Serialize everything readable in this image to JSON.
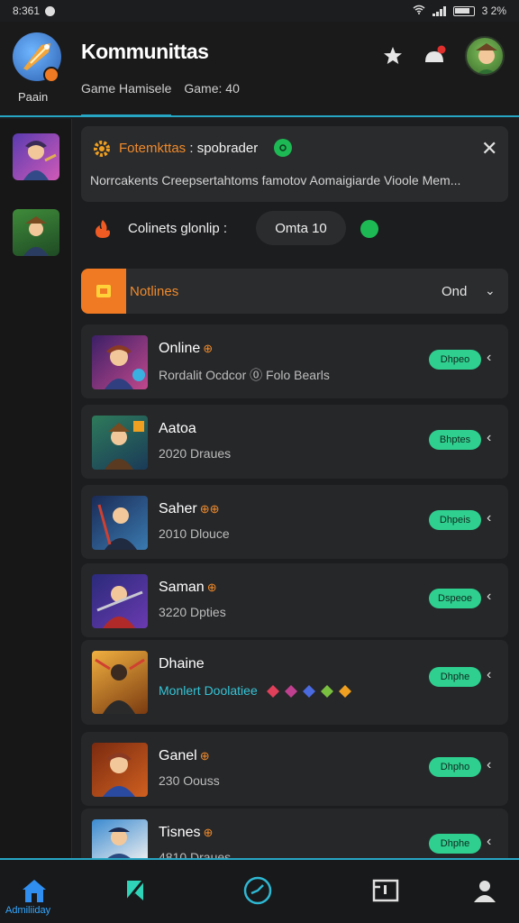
{
  "status": {
    "time": "8:361",
    "battery_text": "3 2%"
  },
  "header": {
    "avatar_caption": "Paain",
    "title": "Kommunittas",
    "subtabs": [
      "Game Hamisele",
      "Game: 40"
    ]
  },
  "notification": {
    "title_accent": "Fotemkttas",
    "title_rest": ": spobrader",
    "body": "Norrcakents Creepsertahtoms famotov Aomaigiarde Vioole Mem..."
  },
  "online": {
    "label": "Colinets glonlip :",
    "pill": "Omta 10"
  },
  "filter": {
    "label": "Notlines",
    "value": "Ond"
  },
  "items": [
    {
      "name": "Online",
      "marker": "⊕",
      "sub": "Rordalit Ocdcor ⓪ Folo Bearls",
      "pill": "Dhpeo"
    },
    {
      "name": "Aatoa",
      "marker": "",
      "sub": "2020 Draues",
      "pill": "Bhptes"
    },
    {
      "name": "Saher",
      "marker": "⊕⊕",
      "sub": "2010 Dlouce",
      "pill": "Dhpeis"
    },
    {
      "name": "Saman",
      "marker": "⊕",
      "sub": "3220 Dpties",
      "pill": "Dspeoe"
    },
    {
      "name": "Dhaine",
      "marker": "",
      "sub": "Monlert Doolatiee",
      "pill": "Dhphe"
    },
    {
      "name": "Ganel",
      "marker": "⊕",
      "sub": "230 Oouss",
      "pill": "Dhpho"
    },
    {
      "name": "Tisnes",
      "marker": "⊕",
      "sub": "4810 Draues",
      "pill": "Dhphe"
    }
  ],
  "bottom_nav": {
    "active_label": "Admiliiday"
  },
  "colors": {
    "accent": "#27a6c4",
    "orange": "#f07a23",
    "green": "#2ecf8f"
  }
}
